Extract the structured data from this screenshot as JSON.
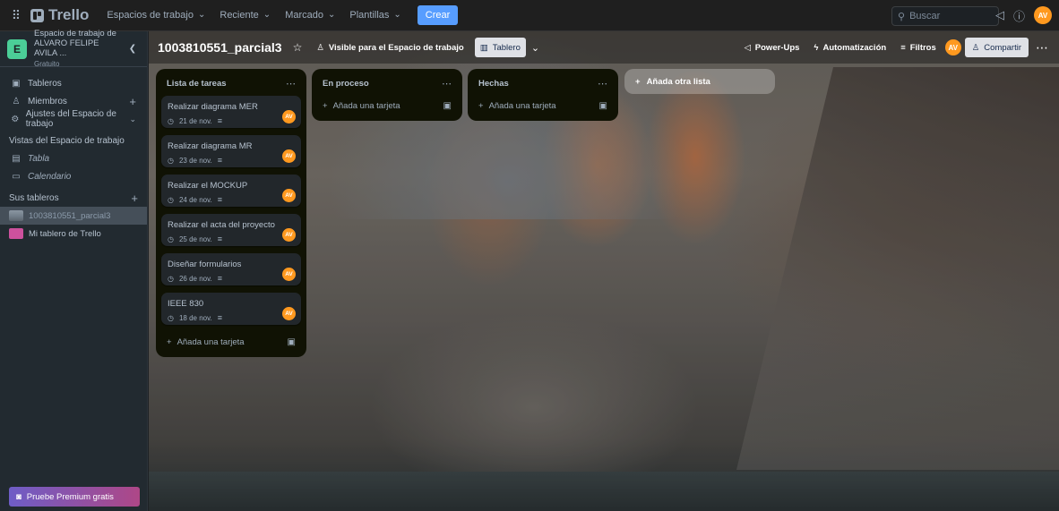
{
  "topbar": {
    "app_name": "Trello",
    "nav": [
      "Espacios de trabajo",
      "Reciente",
      "Marcado",
      "Plantillas"
    ],
    "create": "Crear",
    "search_placeholder": "Buscar",
    "avatar": "AV"
  },
  "sidebar": {
    "workspace_initial": "E",
    "workspace_name_line1": "Espacio de trabajo de",
    "workspace_name_line2": "ALVARO FELIPE AVILA ...",
    "workspace_plan": "Gratuito",
    "items": [
      "Tableros",
      "Miembros",
      "Ajustes del Espacio de trabajo"
    ],
    "views_title": "Vistas del Espacio de trabajo",
    "views": [
      "Tabla",
      "Calendario"
    ],
    "boards_title": "Sus tableros",
    "boards": [
      "1003810551_parcial3",
      "Mi tablero de Trello"
    ],
    "premium": "Pruebe Premium gratis"
  },
  "board": {
    "title": "1003810551_parcial3",
    "visibility": "Visible para el Espacio de trabajo",
    "view": "Tablero",
    "power_ups": "Power-Ups",
    "automation": "Automatización",
    "filters": "Filtros",
    "avatar": "AV",
    "share": "Compartir",
    "add_list": "Añada otra lista",
    "add_card": "Añada una tarjeta",
    "lists": [
      {
        "title": "Lista de tareas",
        "cards": [
          {
            "title": "Realizar diagrama MER",
            "date": "21 de nov."
          },
          {
            "title": "Realizar diagrama MR",
            "date": "23 de nov."
          },
          {
            "title": "Realizar el MOCKUP",
            "date": "24 de nov."
          },
          {
            "title": "Realizar el acta del proyecto",
            "date": "25 de nov."
          },
          {
            "title": "Diseñar formularios",
            "date": "26 de nov."
          },
          {
            "title": "IEEE 830",
            "date": "18 de nov."
          }
        ]
      },
      {
        "title": "En proceso",
        "cards": []
      },
      {
        "title": "Hechas",
        "cards": []
      }
    ]
  },
  "colors": {
    "accent": "#579dff",
    "avatar": "#ff991f",
    "workspace_badge": "#4bce97",
    "list_bg": "#101204",
    "card_bg": "#22272b"
  }
}
